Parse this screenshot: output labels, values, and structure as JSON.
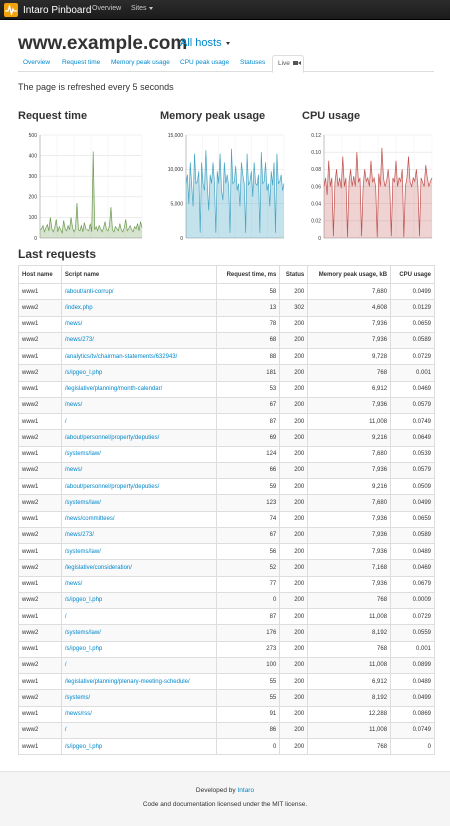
{
  "navbar": {
    "brand": "Intaro Pinboard",
    "links": [
      "Overview",
      "Sites"
    ]
  },
  "header": {
    "host": "www.example.com",
    "all_hosts": "All hosts"
  },
  "tabs": [
    "Overview",
    "Request time",
    "Memory peak usage",
    "CPU peak usage",
    "Statuses",
    "Live"
  ],
  "active_tab": "Live",
  "refresh_note": "The page is refreshed every 5 seconds",
  "charts": {
    "titles": [
      "Request time",
      "Memory peak usage",
      "CPU usage"
    ],
    "colors": {
      "request": "#6d9a4f",
      "memory": "#45a5c4",
      "cpu": "#c0504d"
    }
  },
  "chart_data": [
    {
      "type": "area",
      "title": "Request time",
      "ylim": [
        0,
        500
      ],
      "yticks": [
        "500",
        "400",
        "300",
        "200",
        "100",
        "0"
      ],
      "grid": true,
      "values": [
        40,
        45,
        60,
        30,
        50,
        65,
        35,
        100,
        45,
        30,
        50,
        90,
        30,
        55,
        40,
        25,
        85,
        45,
        35,
        60,
        40,
        100,
        50,
        30,
        45,
        170,
        40,
        35,
        60,
        30,
        75,
        45,
        40,
        35,
        70,
        30,
        420,
        40,
        55,
        35,
        60,
        45,
        30,
        50,
        80,
        40,
        35,
        60,
        150,
        40,
        30,
        55,
        45,
        35,
        70,
        40,
        30,
        50,
        90,
        35,
        45,
        60,
        40,
        30,
        55,
        45,
        70,
        35,
        80,
        50
      ]
    },
    {
      "type": "area",
      "title": "Memory peak usage",
      "ylim": [
        0,
        15000
      ],
      "yticks": [
        "15,000",
        "10,000",
        "5,000",
        "0"
      ],
      "grid": true,
      "values": [
        7936,
        9216,
        5000,
        11008,
        7680,
        4608,
        12288,
        7936,
        8192,
        9728,
        768,
        11008,
        7936,
        6912,
        12800,
        7680,
        4000,
        9216,
        7936,
        11008,
        8192,
        768,
        9728,
        7936,
        12288,
        6912,
        5500,
        11008,
        7936,
        9216,
        7680,
        768,
        13000,
        7936,
        8192,
        10500,
        6912,
        7936,
        4608,
        11008,
        9216,
        7936,
        768,
        12288,
        7680,
        8192,
        9728,
        6000,
        11008,
        7936,
        7680,
        9216,
        768,
        12500,
        7936,
        8192,
        11008,
        6912,
        7936,
        4608,
        9728,
        7680,
        11008,
        768,
        12288,
        7936,
        8192,
        9216,
        6912,
        7936
      ]
    },
    {
      "type": "area",
      "title": "CPU usage",
      "ylim": [
        0,
        0.12
      ],
      "yticks": [
        "0.12",
        "0.10",
        "0.08",
        "0.06",
        "0.04",
        "0.02",
        "0"
      ],
      "grid": true,
      "values": [
        0.06,
        0.07,
        0.05,
        0.09,
        0.06,
        0.07,
        0.002,
        0.065,
        0.08,
        0.06,
        0.07,
        0.058,
        0.095,
        0.06,
        0.07,
        0.001,
        0.066,
        0.08,
        0.06,
        0.072,
        0.06,
        0.1,
        0.065,
        0.07,
        0.002,
        0.06,
        0.08,
        0.066,
        0.07,
        0.06,
        0.09,
        0.065,
        0.07,
        0.06,
        0.001,
        0.075,
        0.06,
        0.105,
        0.07,
        0.06,
        0.066,
        0.08,
        0.06,
        0.002,
        0.07,
        0.065,
        0.09,
        0.06,
        0.07,
        0.066,
        0.08,
        0.001,
        0.06,
        0.07,
        0.095,
        0.065,
        0.06,
        0.07,
        0.066,
        0.08,
        0.06,
        0.002,
        0.07,
        0.065,
        0.06,
        0.085,
        0.07,
        0.06,
        0.066,
        0.07
      ]
    }
  ],
  "requests": {
    "title": "Last requests",
    "columns": [
      "Host name",
      "Script name",
      "Request time, ms",
      "Status",
      "Memory peak usage, kB",
      "CPU usage"
    ],
    "rows": [
      [
        "www1",
        "/about/anti-corrup/",
        "58",
        "200",
        "7,680",
        "0.0499"
      ],
      [
        "www2",
        "/index.php",
        "13",
        "302",
        "4,608",
        "0.0129"
      ],
      [
        "www1",
        "/news/",
        "78",
        "200",
        "7,936",
        "0.0659"
      ],
      [
        "www2",
        "/news/273/",
        "68",
        "200",
        "7,936",
        "0.0589"
      ],
      [
        "www1",
        "/analytics/tv/chairman-statements/632943/",
        "88",
        "200",
        "9,728",
        "0.0729"
      ],
      [
        "www2",
        "/s/ipgeo_l.php",
        "181",
        "200",
        "768",
        "0.001"
      ],
      [
        "www1",
        "/legislative/planning/month-calendar/",
        "53",
        "200",
        "6,912",
        "0.0469"
      ],
      [
        "www2",
        "/news/",
        "67",
        "200",
        "7,936",
        "0.0579"
      ],
      [
        "www1",
        "/",
        "87",
        "200",
        "11,008",
        "0.0749"
      ],
      [
        "www2",
        "/about/personnel/property/deputies/",
        "69",
        "200",
        "9,216",
        "0.0649"
      ],
      [
        "www1",
        "/systems/law/",
        "124",
        "200",
        "7,680",
        "0.0539"
      ],
      [
        "www2",
        "/news/",
        "66",
        "200",
        "7,936",
        "0.0579"
      ],
      [
        "www1",
        "/about/personnel/property/deputies/",
        "59",
        "200",
        "9,216",
        "0.0509"
      ],
      [
        "www2",
        "/systems/law/",
        "123",
        "200",
        "7,680",
        "0.0499"
      ],
      [
        "www1",
        "/news/committees/",
        "74",
        "200",
        "7,936",
        "0.0659"
      ],
      [
        "www2",
        "/news/273/",
        "67",
        "200",
        "7,936",
        "0.0589"
      ],
      [
        "www1",
        "/systems/law/",
        "56",
        "200",
        "7,936",
        "0.0489"
      ],
      [
        "www2",
        "/legislative/consideration/",
        "52",
        "200",
        "7,168",
        "0.0469"
      ],
      [
        "www1",
        "/news/",
        "77",
        "200",
        "7,936",
        "0.0679"
      ],
      [
        "www2",
        "/s/ipgeo_l.php",
        "0",
        "200",
        "768",
        "0.0009"
      ],
      [
        "www1",
        "/",
        "87",
        "200",
        "11,008",
        "0.0729"
      ],
      [
        "www2",
        "/systems/law/",
        "176",
        "200",
        "8,192",
        "0.0559"
      ],
      [
        "www1",
        "/s/ipgeo_l.php",
        "273",
        "200",
        "768",
        "0.001"
      ],
      [
        "www2",
        "/",
        "100",
        "200",
        "11,008",
        "0.0899"
      ],
      [
        "www1",
        "/legislative/planning/plenary-meeting-schedule/",
        "55",
        "200",
        "6,912",
        "0.0489"
      ],
      [
        "www2",
        "/systems/",
        "55",
        "200",
        "8,192",
        "0.0499"
      ],
      [
        "www1",
        "/news/rss/",
        "91",
        "200",
        "12,288",
        "0.0869"
      ],
      [
        "www2",
        "/",
        "86",
        "200",
        "11,008",
        "0.0749"
      ],
      [
        "www1",
        "/s/ipgeo_l.php",
        "0",
        "200",
        "768",
        "0"
      ]
    ]
  },
  "footer": {
    "developed_by": "Developed by",
    "developer": "Intaro",
    "license": "Code and documentation licensed under the MIT license."
  }
}
